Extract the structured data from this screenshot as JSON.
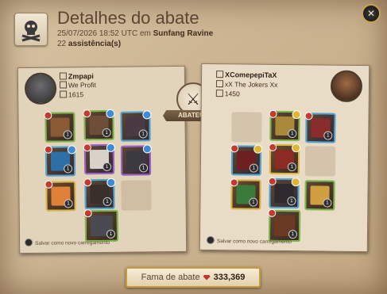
{
  "header": {
    "title": "Detalhes do abate",
    "timestamp": "25/07/2026 18:52 UTC em",
    "location": "Sunfang Ravine",
    "assists_count": "22",
    "assists_label": "assistência(s)"
  },
  "killer": {
    "name": "Zmpapi",
    "guild": "We Profit",
    "item_power": "1615",
    "saved_note": "Salvar como novo carregamento"
  },
  "victim": {
    "name": "XComepepiTaX",
    "guild": "xX The Jokers Xx",
    "item_power": "1450",
    "saved_note": "Salvar como novo carregamento"
  },
  "center": {
    "badge_label": "ABATEU",
    "icon": "crossed-swords-icon"
  },
  "footer": {
    "fame_label": "Fama de abate",
    "fame_value": "333,369",
    "fame_icon": "blood-gem-icon"
  },
  "colors": {
    "parchment": "#cdb593",
    "tier_green": "#7ab547",
    "tier_blue": "#4fa3d1",
    "tier_purple": "#9c5fc4",
    "tier_gold": "#d9b343"
  }
}
